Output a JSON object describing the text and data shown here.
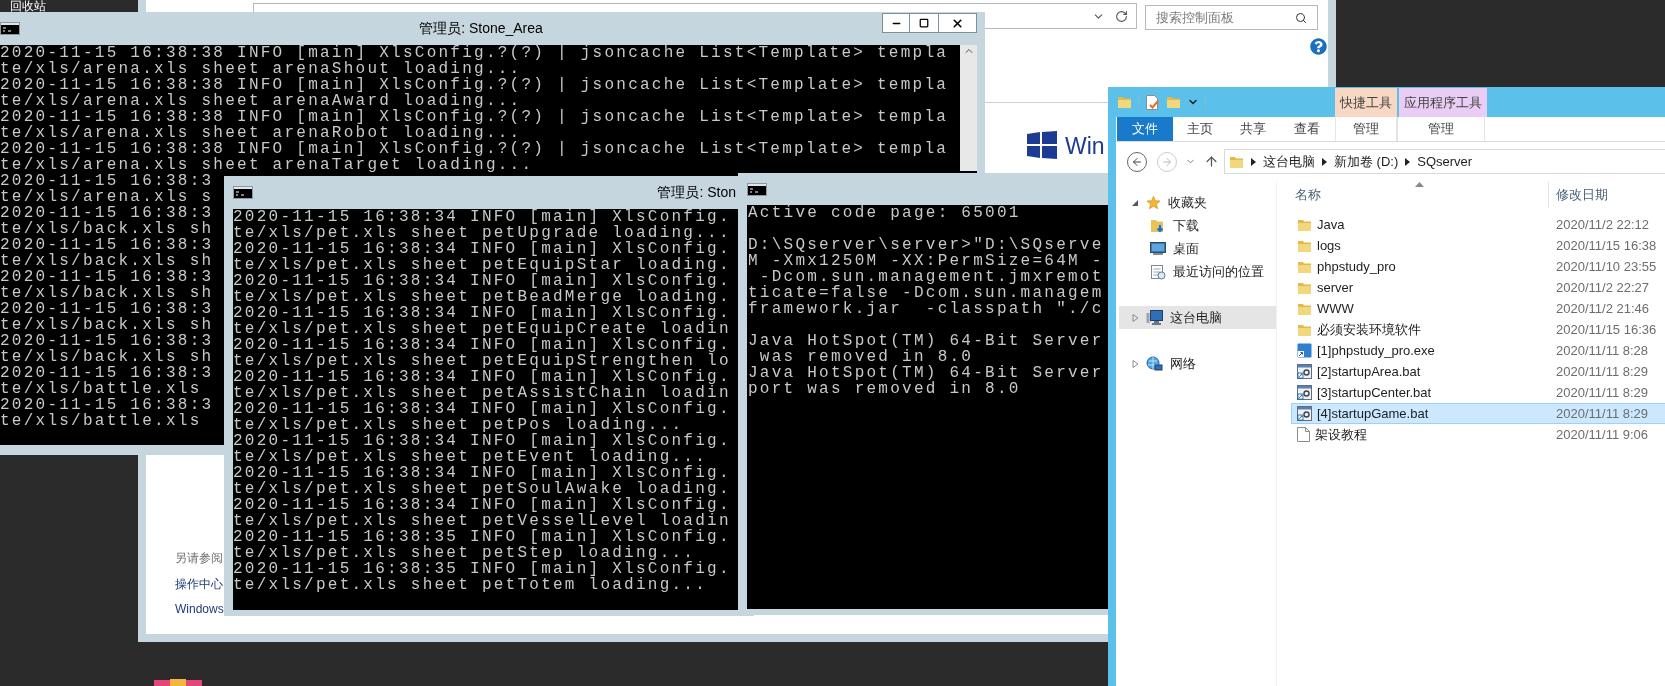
{
  "desktop": {
    "icon_label": "回收站"
  },
  "control_panel": {
    "search": {
      "placeholder": "搜索控制面板"
    },
    "logo_text": "Win",
    "see_also": {
      "heading": "另请参阅",
      "links": [
        "操作中心",
        "Windows"
      ]
    }
  },
  "consoles": [
    {
      "title": "管理员: Stone_Area",
      "blocks": [
        [
          "2020-11-15 16:38:38 INFO [main] XlsConfig.?(?) | jsoncache List<Template> templa",
          "te/xls/arena.xls sheet arenaShout loading...",
          "2020-11-15 16:38:38 INFO [main] XlsConfig.?(?) | jsoncache List<Template> templa",
          "te/xls/arena.xls sheet arenaAward loading...",
          "2020-11-15 16:38:38 INFO [main] XlsConfig.?(?) | jsoncache List<Template> templa",
          "te/xls/arena.xls sheet arenaRobot loading...",
          "2020-11-15 16:38:38 INFO [main] XlsConfig.?(?) | jsoncache List<Template> templa",
          "te/xls/arena.xls sheet arenaTarget loading...",
          "2020-11-15 16:38:3",
          "te/xls/arena.xls s",
          "2020-11-15 16:38:3",
          "te/xls/back.xls sh",
          "2020-11-15 16:38:3",
          "te/xls/back.xls sh",
          "2020-11-15 16:38:3",
          "te/xls/back.xls sh",
          "2020-11-15 16:38:3",
          "te/xls/back.xls sh",
          "2020-11-15 16:38:3",
          "te/xls/back.xls sh",
          "2020-11-15 16:38:3",
          "te/xls/battle.xls",
          "2020-11-15 16:38:3",
          "te/xls/battle.xls"
        ]
      ]
    },
    {
      "title": "管理员: Ston",
      "blocks": [
        [
          "2020-11-15 16:38:34 INFO [main] XlsConfig.",
          "te/xls/pet.xls sheet petUpgrade loading...",
          "2020-11-15 16:38:34 INFO [main] XlsConfig.",
          "te/xls/pet.xls sheet petEquipStar loading.",
          "2020-11-15 16:38:34 INFO [main] XlsConfig.",
          "te/xls/pet.xls sheet petBeadMerge loading.",
          "2020-11-15 16:38:34 INFO [main] XlsConfig.",
          "te/xls/pet.xls sheet petEquipCreate loadin",
          "2020-11-15 16:38:34 INFO [main] XlsConfig.",
          "te/xls/pet.xls sheet petEquipStrengthen lo",
          "2020-11-15 16:38:34 INFO [main] XlsConfig.",
          "te/xls/pet.xls sheet petAssistChain loadin",
          "2020-11-15 16:38:34 INFO [main] XlsConfig.",
          "te/xls/pet.xls sheet petPos loading...",
          "2020-11-15 16:38:34 INFO [main] XlsConfig.",
          "te/xls/pet.xls sheet petEvent loading...",
          "2020-11-15 16:38:34 INFO [main] XlsConfig.",
          "te/xls/pet.xls sheet petSoulAwake loading.",
          "2020-11-15 16:38:34 INFO [main] XlsConfig.",
          "te/xls/pet.xls sheet petVesselLevel loadin",
          "2020-11-15 16:38:35 INFO [main] XlsConfig.",
          "te/xls/pet.xls sheet petStep loading...",
          "2020-11-15 16:38:35 INFO [main] XlsConfig.",
          "te/xls/pet.xls sheet petTotem loading..."
        ]
      ]
    },
    {
      "blocks": [
        [
          "Active code page: 65001"
        ],
        [
          "D:\\SQserver\\server>\"D:\\SQserve",
          "M -Xmx1250M -XX:PermSize=64M -",
          " -Dcom.sun.management.jmxremot",
          "ticate=false -Dcom.sun.managem",
          "framework.jar  -classpath \"./c"
        ],
        [
          "Java HotSpot(TM) 64-Bit Server",
          " was removed in 8.0",
          "Java HotSpot(TM) 64-Bit Server",
          "port was removed in 8.0"
        ]
      ]
    }
  ],
  "explorer": {
    "context_tabs": [
      {
        "label": "快捷工具",
        "color": "#f8d8c4"
      },
      {
        "label": "应用程序工具",
        "color": "#eacdf4"
      }
    ],
    "ribbon_tabs": [
      {
        "label": "文件",
        "kind": "file"
      },
      {
        "label": "主页",
        "kind": "tab"
      },
      {
        "label": "共享",
        "kind": "tab"
      },
      {
        "label": "查看",
        "kind": "tab"
      },
      {
        "label": "管理",
        "kind": "tab"
      },
      {
        "label": "管理",
        "kind": "tab"
      }
    ],
    "address": [
      "这台电脑",
      "新加卷 (D:)",
      "SQserver"
    ],
    "nav_pane": [
      {
        "label": "收藏夹",
        "kind": "favorites",
        "expanded": true,
        "selected": false,
        "children": [
          {
            "label": "下载",
            "kind": "downloads",
            "selected": false
          },
          {
            "label": "桌面",
            "kind": "desktop",
            "selected": false
          },
          {
            "label": "最近访问的位置",
            "kind": "recent",
            "selected": false
          }
        ]
      },
      {
        "label": "这台电脑",
        "kind": "computer",
        "expanded": false,
        "selected": true
      },
      {
        "label": "网络",
        "kind": "network",
        "expanded": false,
        "selected": false
      }
    ],
    "columns": [
      "名称",
      "修改日期"
    ],
    "files": [
      {
        "name": "Java",
        "modified": "2020/11/2 22:12",
        "kind": "folder",
        "selected": false
      },
      {
        "name": "logs",
        "modified": "2020/11/15 16:38",
        "kind": "folder",
        "selected": false
      },
      {
        "name": "phpstudy_pro",
        "modified": "2020/11/10 23:55",
        "kind": "folder",
        "selected": false
      },
      {
        "name": "server",
        "modified": "2020/11/2 22:27",
        "kind": "folder",
        "selected": false
      },
      {
        "name": "WWW",
        "modified": "2020/11/2 21:46",
        "kind": "folder",
        "selected": false
      },
      {
        "name": "必须安装环境软件",
        "modified": "2020/11/15 16:36",
        "kind": "folder",
        "selected": false
      },
      {
        "name": "[1]phpstudy_pro.exe",
        "modified": "2020/11/11 8:28",
        "kind": "exe",
        "selected": false
      },
      {
        "name": "[2]startupArea.bat",
        "modified": "2020/11/11 8:29",
        "kind": "bat",
        "selected": false
      },
      {
        "name": "[3]startupCenter.bat",
        "modified": "2020/11/11 8:29",
        "kind": "bat",
        "selected": false
      },
      {
        "name": "[4]startupGame.bat",
        "modified": "2020/11/11 8:29",
        "kind": "bat",
        "selected": true
      },
      {
        "name": "架设教程",
        "modified": "2020/11/11 9:06",
        "kind": "file",
        "selected": false
      }
    ]
  }
}
